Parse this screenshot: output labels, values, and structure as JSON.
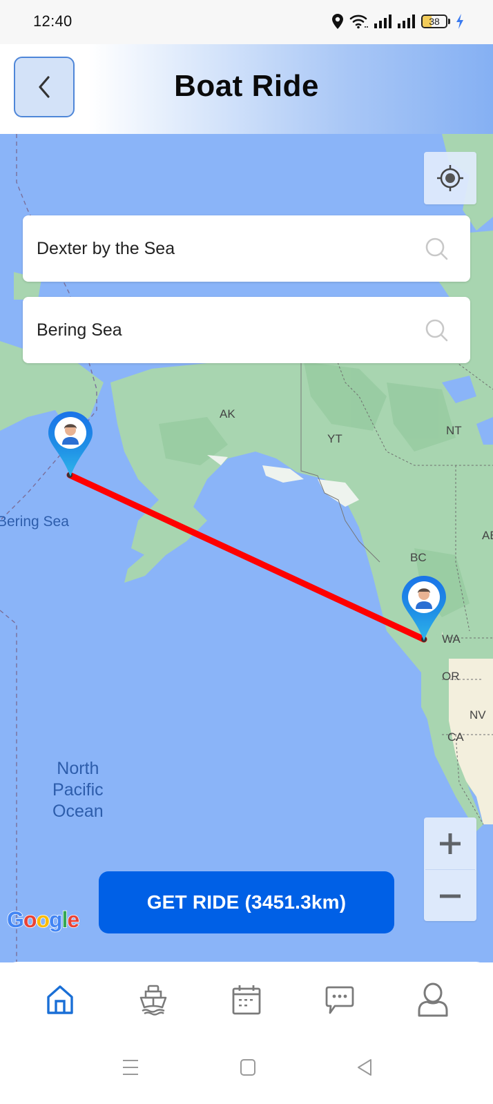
{
  "status_bar": {
    "time": "12:40",
    "icons": [
      "location-icon",
      "wifi-icon",
      "signal-icon",
      "signal-icon",
      "battery-icon",
      "charging-icon"
    ],
    "battery_level": "38",
    "battery_fraction": 0.38
  },
  "header": {
    "title": "Boat Ride",
    "back_icon": "chevron-left-icon"
  },
  "map": {
    "origin_field": {
      "value": "Dexter by the Sea",
      "icon": "search-icon"
    },
    "destination_field": {
      "value": "Bering Sea",
      "icon": "search-icon"
    },
    "labels": {
      "ak": "AK",
      "yt": "YT",
      "nt": "NT",
      "bc": "BC",
      "ab": "AB",
      "wa": "WA",
      "or": "OR",
      "nv": "NV",
      "ca": "CA",
      "bering_sea": "Bering Sea",
      "ocean_line1": "North",
      "ocean_line2": "Pacific",
      "ocean_line3": "Ocean"
    },
    "route_color": "#ff0000",
    "marker_color": "#1a73e8",
    "attribution": "Google",
    "zoom_in_label": "+",
    "zoom_out_label": "−"
  },
  "action": {
    "get_ride_label": "GET RIDE (3451.3km)",
    "color": "#0060e6"
  },
  "bottom_nav": {
    "items": [
      {
        "name": "home",
        "icon": "home-icon",
        "active": true
      },
      {
        "name": "boats",
        "icon": "ship-icon",
        "active": false
      },
      {
        "name": "bookings",
        "icon": "calendar-icon",
        "active": false
      },
      {
        "name": "messages",
        "icon": "chat-icon",
        "active": false
      },
      {
        "name": "profile",
        "icon": "user-icon",
        "active": false
      }
    ],
    "active_color": "#1a6fd6",
    "inactive_color": "#7a7a7a"
  },
  "system_nav": {
    "buttons": [
      "menu-icon",
      "home-square-icon",
      "back-triangle-icon"
    ]
  }
}
